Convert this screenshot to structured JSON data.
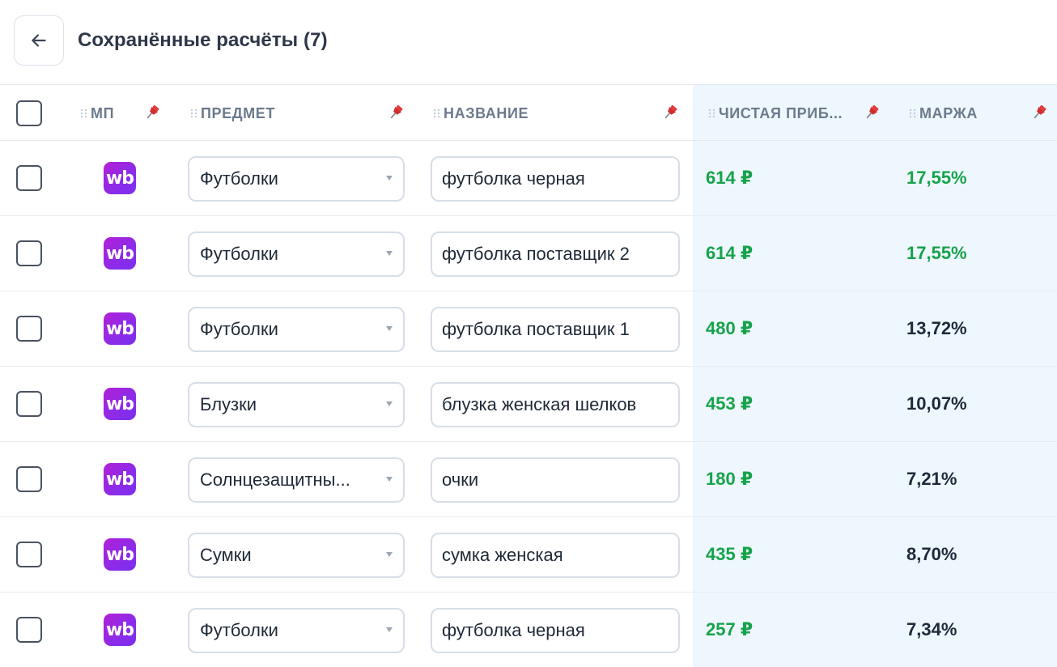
{
  "header": {
    "title": "Сохранённые расчёты (7)",
    "back_icon": "arrow-left-icon"
  },
  "columns": {
    "mp": "МП",
    "subject": "ПРЕДМЕТ",
    "name": "НАЗВАНИЕ",
    "profit": "ЧИСТАЯ ПРИБ...",
    "margin": "МАРЖА"
  },
  "marketplace_logo_text": "wb",
  "colors": {
    "profit_green": "#16a34a",
    "highlight_bg": "#eef6fe",
    "wb_purple": "#9b27e0"
  },
  "rows": [
    {
      "subject": "Футболки",
      "name": "футболка черная",
      "profit": "614 ₽",
      "margin": "17,55%",
      "margin_positive": true
    },
    {
      "subject": "Футболки",
      "name": "футболка поставщик 2",
      "profit": "614 ₽",
      "margin": "17,55%",
      "margin_positive": true
    },
    {
      "subject": "Футболки",
      "name": "футболка поставщик 1",
      "profit": "480 ₽",
      "margin": "13,72%",
      "margin_positive": false
    },
    {
      "subject": "Блузки",
      "name": "блузка женская шелков",
      "profit": "453 ₽",
      "margin": "10,07%",
      "margin_positive": false
    },
    {
      "subject": "Солнцезащитны...",
      "name": "очки",
      "profit": "180 ₽",
      "margin": "7,21%",
      "margin_positive": false
    },
    {
      "subject": "Сумки",
      "name": "сумка женская",
      "profit": "435 ₽",
      "margin": "8,70%",
      "margin_positive": false
    },
    {
      "subject": "Футболки",
      "name": "футболка черная",
      "profit": "257 ₽",
      "margin": "7,34%",
      "margin_positive": false
    }
  ]
}
